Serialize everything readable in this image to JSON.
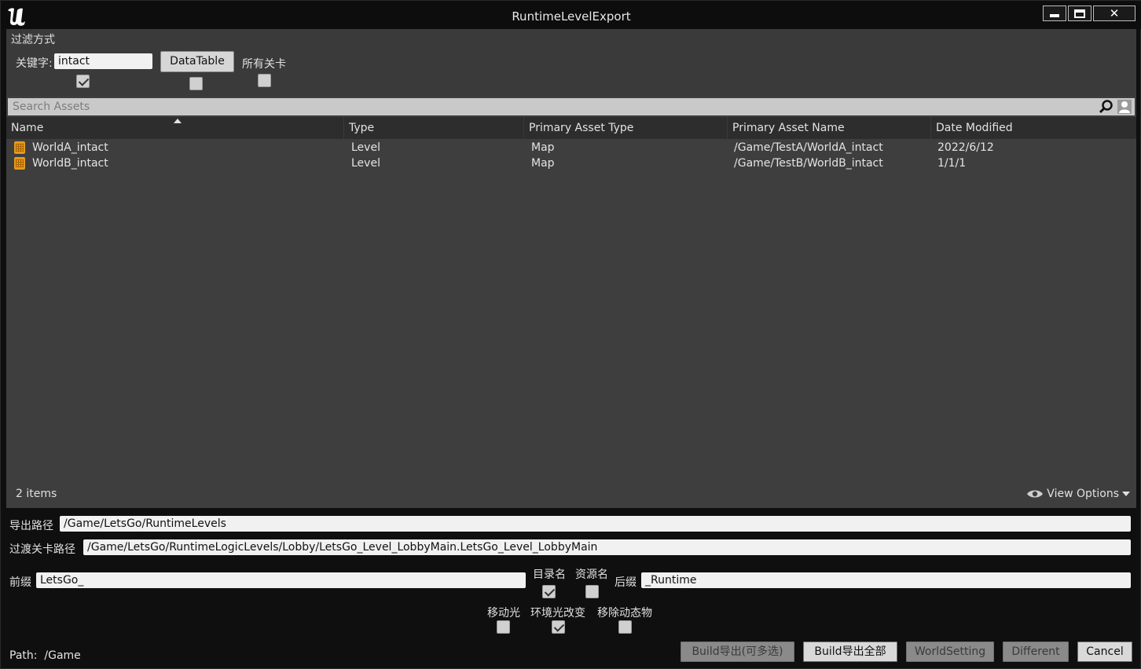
{
  "window": {
    "title": "RuntimeLevelExport",
    "controls": [
      "minimize-icon",
      "maximize-icon",
      "close-icon"
    ]
  },
  "filter": {
    "title": "过滤方式",
    "keyword_label": "关键字:",
    "keyword_value": "intact",
    "keyword_checked": true,
    "datatable_button": "DataTable",
    "datatable_checked": false,
    "all_levels_label": "所有关卡",
    "all_levels_checked": false
  },
  "search": {
    "placeholder": "Search Assets",
    "icon": "search-icon",
    "user_icon": "user-icon"
  },
  "table": {
    "columns": [
      "Name",
      "Type",
      "Primary Asset Type",
      "Primary Asset Name",
      "Date Modified"
    ],
    "sort_column": "Name",
    "sort_direction": "ascending",
    "rows": [
      {
        "name": "WorldA_intact",
        "type": "Level",
        "primary_type": "Map",
        "primary_name": "/Game/TestA/WorldA_intact",
        "date": "2022/6/12",
        "icon": "level-icon"
      },
      {
        "name": "WorldB_intact",
        "type": "Level",
        "primary_type": "Map",
        "primary_name": "/Game/TestB/WorldB_intact",
        "date": "1/1/1",
        "icon": "level-icon"
      }
    ],
    "item_count": "2 items",
    "view_options": "View Options"
  },
  "export": {
    "export_path_label": "导出路径",
    "export_path_value": "/Game/LetsGo/RuntimeLevels",
    "transition_path_label": "过渡关卡路径",
    "transition_path_value": "/Game/LetsGo/RuntimeLogicLevels/Lobby/LetsGo_Level_LobbyMain.LetsGo_Level_LobbyMain",
    "prefix_label": "前缀",
    "prefix_value": "LetsGo_",
    "dir_name_label": "目录名",
    "dir_name_checked": true,
    "asset_name_label": "资源名",
    "asset_name_checked": false,
    "suffix_label": "后缀",
    "suffix_value": "_Runtime",
    "move_light_label": "移动光",
    "move_light_checked": false,
    "env_light_label": "环境光改变",
    "env_light_checked": true,
    "remove_dynamic_label": "移除动态物",
    "remove_dynamic_checked": false
  },
  "bottom": {
    "path_label": "Path:",
    "path_value": "/Game",
    "buttons": [
      "Build导出(可多选)",
      "Build导出全部",
      "WorldSetting",
      "Different",
      "Cancel"
    ]
  }
}
